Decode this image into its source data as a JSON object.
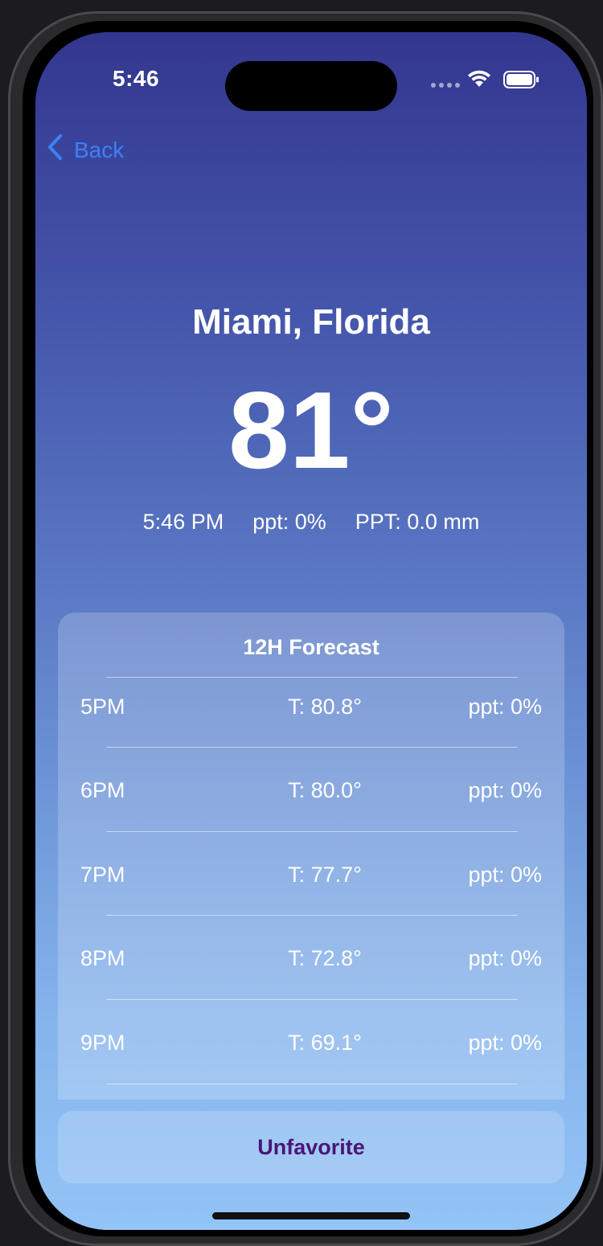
{
  "status_bar": {
    "time": "5:46"
  },
  "nav": {
    "back_label": "Back"
  },
  "weather": {
    "city": "Miami, Florida",
    "temperature": "81°",
    "local_time": "5:46 PM",
    "precip_chance": "ppt: 0%",
    "precip_amount": "PPT: 0.0 mm"
  },
  "forecast": {
    "title": "12H Forecast",
    "rows": [
      {
        "hour": "5PM",
        "temp": "T: 80.8°",
        "ppt": "ppt: 0%"
      },
      {
        "hour": "6PM",
        "temp": "T: 80.0°",
        "ppt": "ppt: 0%"
      },
      {
        "hour": "7PM",
        "temp": "T: 77.7°",
        "ppt": "ppt: 0%"
      },
      {
        "hour": "8PM",
        "temp": "T: 72.8°",
        "ppt": "ppt: 0%"
      },
      {
        "hour": "9PM",
        "temp": "T: 69.1°",
        "ppt": "ppt: 0%"
      }
    ]
  },
  "actions": {
    "unfavorite_label": "Unfavorite"
  },
  "colors": {
    "accent_blue": "#3b82f6",
    "button_text": "#4a1676",
    "gradient_top": "#33368f",
    "gradient_bottom": "#93c4f6"
  }
}
